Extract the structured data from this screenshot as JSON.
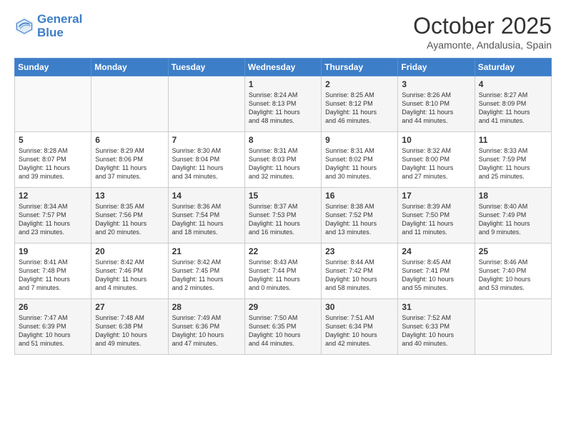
{
  "header": {
    "logo_line1": "General",
    "logo_line2": "Blue",
    "title": "October 2025",
    "subtitle": "Ayamonte, Andalusia, Spain"
  },
  "columns": [
    "Sunday",
    "Monday",
    "Tuesday",
    "Wednesday",
    "Thursday",
    "Friday",
    "Saturday"
  ],
  "weeks": [
    [
      {
        "day": "",
        "info": ""
      },
      {
        "day": "",
        "info": ""
      },
      {
        "day": "",
        "info": ""
      },
      {
        "day": "1",
        "info": "Sunrise: 8:24 AM\nSunset: 8:13 PM\nDaylight: 11 hours\nand 48 minutes."
      },
      {
        "day": "2",
        "info": "Sunrise: 8:25 AM\nSunset: 8:12 PM\nDaylight: 11 hours\nand 46 minutes."
      },
      {
        "day": "3",
        "info": "Sunrise: 8:26 AM\nSunset: 8:10 PM\nDaylight: 11 hours\nand 44 minutes."
      },
      {
        "day": "4",
        "info": "Sunrise: 8:27 AM\nSunset: 8:09 PM\nDaylight: 11 hours\nand 41 minutes."
      }
    ],
    [
      {
        "day": "5",
        "info": "Sunrise: 8:28 AM\nSunset: 8:07 PM\nDaylight: 11 hours\nand 39 minutes."
      },
      {
        "day": "6",
        "info": "Sunrise: 8:29 AM\nSunset: 8:06 PM\nDaylight: 11 hours\nand 37 minutes."
      },
      {
        "day": "7",
        "info": "Sunrise: 8:30 AM\nSunset: 8:04 PM\nDaylight: 11 hours\nand 34 minutes."
      },
      {
        "day": "8",
        "info": "Sunrise: 8:31 AM\nSunset: 8:03 PM\nDaylight: 11 hours\nand 32 minutes."
      },
      {
        "day": "9",
        "info": "Sunrise: 8:31 AM\nSunset: 8:02 PM\nDaylight: 11 hours\nand 30 minutes."
      },
      {
        "day": "10",
        "info": "Sunrise: 8:32 AM\nSunset: 8:00 PM\nDaylight: 11 hours\nand 27 minutes."
      },
      {
        "day": "11",
        "info": "Sunrise: 8:33 AM\nSunset: 7:59 PM\nDaylight: 11 hours\nand 25 minutes."
      }
    ],
    [
      {
        "day": "12",
        "info": "Sunrise: 8:34 AM\nSunset: 7:57 PM\nDaylight: 11 hours\nand 23 minutes."
      },
      {
        "day": "13",
        "info": "Sunrise: 8:35 AM\nSunset: 7:56 PM\nDaylight: 11 hours\nand 20 minutes."
      },
      {
        "day": "14",
        "info": "Sunrise: 8:36 AM\nSunset: 7:54 PM\nDaylight: 11 hours\nand 18 minutes."
      },
      {
        "day": "15",
        "info": "Sunrise: 8:37 AM\nSunset: 7:53 PM\nDaylight: 11 hours\nand 16 minutes."
      },
      {
        "day": "16",
        "info": "Sunrise: 8:38 AM\nSunset: 7:52 PM\nDaylight: 11 hours\nand 13 minutes."
      },
      {
        "day": "17",
        "info": "Sunrise: 8:39 AM\nSunset: 7:50 PM\nDaylight: 11 hours\nand 11 minutes."
      },
      {
        "day": "18",
        "info": "Sunrise: 8:40 AM\nSunset: 7:49 PM\nDaylight: 11 hours\nand 9 minutes."
      }
    ],
    [
      {
        "day": "19",
        "info": "Sunrise: 8:41 AM\nSunset: 7:48 PM\nDaylight: 11 hours\nand 7 minutes."
      },
      {
        "day": "20",
        "info": "Sunrise: 8:42 AM\nSunset: 7:46 PM\nDaylight: 11 hours\nand 4 minutes."
      },
      {
        "day": "21",
        "info": "Sunrise: 8:42 AM\nSunset: 7:45 PM\nDaylight: 11 hours\nand 2 minutes."
      },
      {
        "day": "22",
        "info": "Sunrise: 8:43 AM\nSunset: 7:44 PM\nDaylight: 11 hours\nand 0 minutes."
      },
      {
        "day": "23",
        "info": "Sunrise: 8:44 AM\nSunset: 7:42 PM\nDaylight: 10 hours\nand 58 minutes."
      },
      {
        "day": "24",
        "info": "Sunrise: 8:45 AM\nSunset: 7:41 PM\nDaylight: 10 hours\nand 55 minutes."
      },
      {
        "day": "25",
        "info": "Sunrise: 8:46 AM\nSunset: 7:40 PM\nDaylight: 10 hours\nand 53 minutes."
      }
    ],
    [
      {
        "day": "26",
        "info": "Sunrise: 7:47 AM\nSunset: 6:39 PM\nDaylight: 10 hours\nand 51 minutes."
      },
      {
        "day": "27",
        "info": "Sunrise: 7:48 AM\nSunset: 6:38 PM\nDaylight: 10 hours\nand 49 minutes."
      },
      {
        "day": "28",
        "info": "Sunrise: 7:49 AM\nSunset: 6:36 PM\nDaylight: 10 hours\nand 47 minutes."
      },
      {
        "day": "29",
        "info": "Sunrise: 7:50 AM\nSunset: 6:35 PM\nDaylight: 10 hours\nand 44 minutes."
      },
      {
        "day": "30",
        "info": "Sunrise: 7:51 AM\nSunset: 6:34 PM\nDaylight: 10 hours\nand 42 minutes."
      },
      {
        "day": "31",
        "info": "Sunrise: 7:52 AM\nSunset: 6:33 PM\nDaylight: 10 hours\nand 40 minutes."
      },
      {
        "day": "",
        "info": ""
      }
    ]
  ]
}
